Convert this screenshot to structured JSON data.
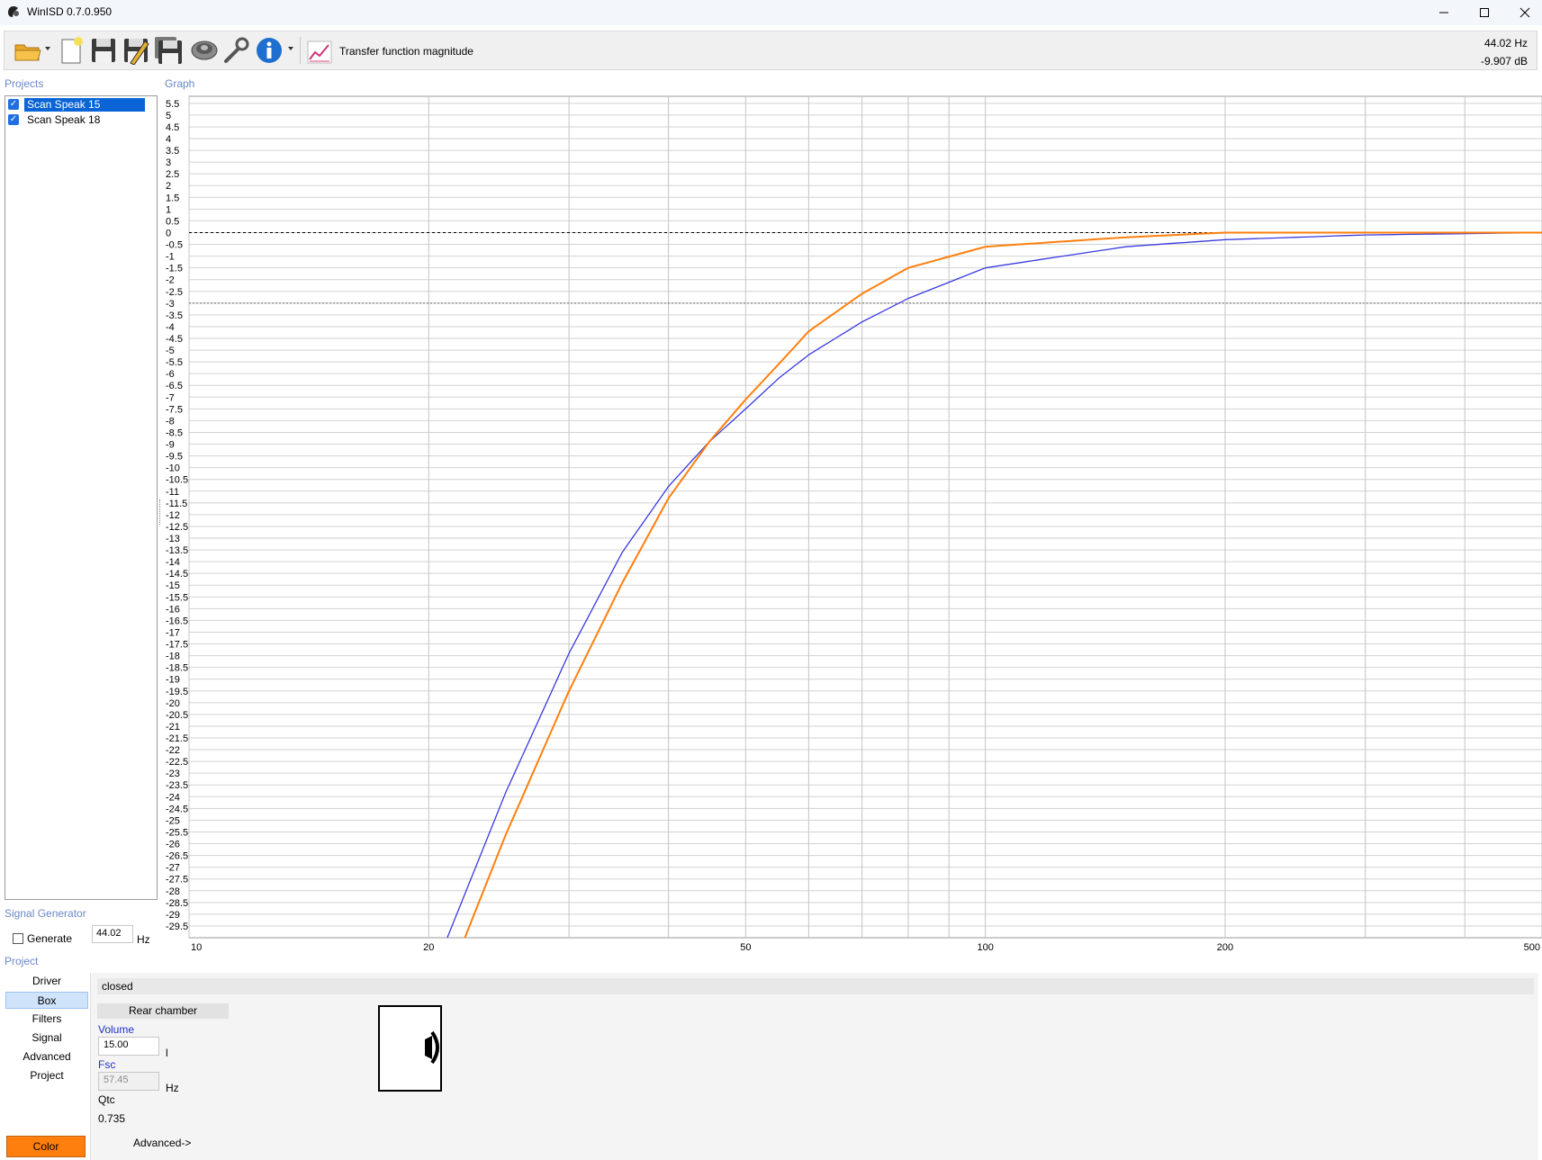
{
  "window": {
    "title": "WinISD 0.7.0.950"
  },
  "toolbar": {
    "graph_type_label": "Transfer function magnitude",
    "readout_freq": "44.02 Hz",
    "readout_level": "-9.907 dB",
    "tools": [
      "open-folder-icon",
      "new-document-icon",
      "save-icon",
      "save-as-icon",
      "save-all-icon",
      "driver-speaker-icon",
      "tools-wrench-icon",
      "info-icon"
    ]
  },
  "projects": {
    "title": "Projects",
    "items": [
      {
        "label": "Scan Speak 15",
        "checked": true,
        "selected": true
      },
      {
        "label": "Scan Speak 18",
        "checked": true,
        "selected": false
      }
    ]
  },
  "graph": {
    "title": "Graph"
  },
  "signal_generator": {
    "title": "Signal Generator",
    "generate_label": "Generate",
    "generate_checked": false,
    "frequency": "44.02",
    "unit": "Hz"
  },
  "project_nav": {
    "title": "Project",
    "items": [
      "Driver",
      "Box",
      "Filters",
      "Signal",
      "Advanced",
      "Project"
    ],
    "active": "Box",
    "color_label": "Color",
    "color": "#ff7f0e"
  },
  "box_panel": {
    "type": "closed",
    "rear_chamber": "Rear chamber",
    "volume_label": "Volume",
    "volume": "15.00",
    "volume_unit": "l",
    "fsc_label": "Fsc",
    "fsc": "57.45",
    "fsc_unit": "Hz",
    "qtc_label": "Qtc",
    "qtc": "0.735",
    "advanced_link": "Advanced->"
  },
  "chart_data": {
    "type": "line",
    "xscale": "log",
    "xlim": [
      10,
      500
    ],
    "ylim": [
      -30,
      5.8
    ],
    "x_ticks": [
      10,
      20,
      50,
      100,
      200,
      500
    ],
    "y_ticks": [
      5.5,
      5,
      4.5,
      4,
      3.5,
      3,
      2.5,
      2,
      1.5,
      1,
      0.5,
      0,
      -0.5,
      -1,
      -1.5,
      -2,
      -2.5,
      -3,
      -3.5,
      -4,
      -4.5,
      -5,
      -5.5,
      -6,
      -6.5,
      -7,
      -7.5,
      -8,
      -8.5,
      -9,
      -9.5,
      -10,
      -10.5,
      -11,
      -11.5,
      -12,
      -12.5,
      -13,
      -13.5,
      -14,
      -14.5,
      -15,
      -15.5,
      -16,
      -16.5,
      -17,
      -17.5,
      -18,
      -18.5,
      -19,
      -19.5,
      -20,
      -20.5,
      -21,
      -21.5,
      -22,
      -22.5,
      -23,
      -23.5,
      -24,
      -24.5,
      -25,
      -25.5,
      -26,
      -26.5,
      -27,
      -27.5,
      -28,
      -28.5,
      -29,
      -29.5
    ],
    "grid": true,
    "reference_lines": [
      0,
      -3
    ],
    "series": [
      {
        "name": "Scan Speak 15",
        "color": "#ff7f0e",
        "x": [
          22.2,
          25,
          30,
          35,
          40,
          45,
          50,
          55,
          60,
          70,
          80,
          100,
          150,
          200,
          300,
          500
        ],
        "y": [
          -30,
          -25.6,
          -19.5,
          -14.9,
          -11.3,
          -8.9,
          -7.1,
          -5.6,
          -4.2,
          -2.6,
          -1.5,
          -0.6,
          -0.2,
          0,
          0,
          0
        ]
      },
      {
        "name": "Scan Speak 18",
        "color": "#3a3ae0",
        "x": [
          21.1,
          25,
          30,
          35,
          40,
          45,
          50,
          55,
          60,
          70,
          80,
          100,
          150,
          200,
          300,
          500
        ],
        "y": [
          -30,
          -23.8,
          -17.9,
          -13.6,
          -10.8,
          -8.9,
          -7.5,
          -6.2,
          -5.2,
          -3.8,
          -2.8,
          -1.5,
          -0.6,
          -0.3,
          -0.1,
          0
        ]
      }
    ]
  }
}
